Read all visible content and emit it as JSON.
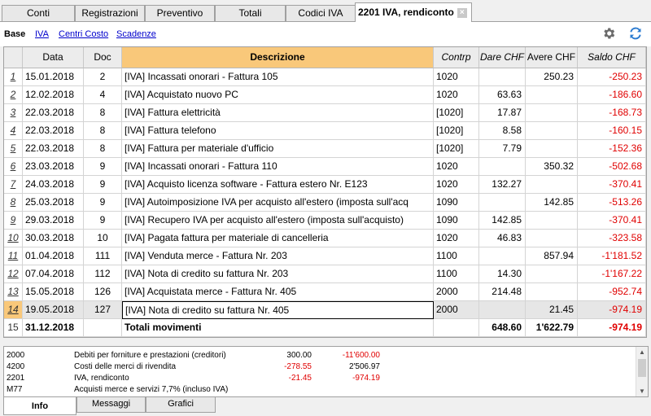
{
  "tabs": [
    {
      "label": "Conti"
    },
    {
      "label": "Registrazioni"
    },
    {
      "label": "Preventivo"
    },
    {
      "label": "Totali"
    },
    {
      "label": "Codici IVA"
    },
    {
      "label": "2201 IVA, rendiconto",
      "active": true
    }
  ],
  "close_symbol": "×",
  "subbar": {
    "base": "Base",
    "links": [
      "IVA",
      "Centri Costo",
      "Scadenze"
    ]
  },
  "icons": {
    "settings": "gear-icon",
    "refresh": "refresh-icon",
    "accent": "#2b7bd0"
  },
  "columns": {
    "date": "Data",
    "doc": "Doc",
    "desc": "Descrizione",
    "contra": "Contrp",
    "debit": "Dare CHF",
    "credit": "Avere CHF",
    "balance": "Saldo CHF"
  },
  "rows": [
    {
      "n": "1",
      "date": "15.01.2018",
      "doc": "2",
      "desc": "[IVA] Incassati onorari - Fattura 105",
      "contra": "1020",
      "debit": "",
      "credit": "250.23",
      "balance": "-250.23"
    },
    {
      "n": "2",
      "date": "12.02.2018",
      "doc": "4",
      "desc": "[IVA] Acquistato nuovo PC",
      "contra": "1020",
      "debit": "63.63",
      "credit": "",
      "balance": "-186.60"
    },
    {
      "n": "3",
      "date": "22.03.2018",
      "doc": "8",
      "desc": "[IVA] Fattura elettricità",
      "contra": "[1020]",
      "debit": "17.87",
      "credit": "",
      "balance": "-168.73"
    },
    {
      "n": "4",
      "date": "22.03.2018",
      "doc": "8",
      "desc": "[IVA] Fattura telefono",
      "contra": "[1020]",
      "debit": "8.58",
      "credit": "",
      "balance": "-160.15"
    },
    {
      "n": "5",
      "date": "22.03.2018",
      "doc": "8",
      "desc": "[IVA] Fattura per materiale d'ufficio",
      "contra": "[1020]",
      "debit": "7.79",
      "credit": "",
      "balance": "-152.36"
    },
    {
      "n": "6",
      "date": "23.03.2018",
      "doc": "9",
      "desc": "[IVA] Incassati onorari - Fattura 110",
      "contra": "1020",
      "debit": "",
      "credit": "350.32",
      "balance": "-502.68"
    },
    {
      "n": "7",
      "date": "24.03.2018",
      "doc": "9",
      "desc": "[IVA] Acquisto licenza software - Fattura estero Nr. E123",
      "contra": "1020",
      "debit": "132.27",
      "credit": "",
      "balance": "-370.41"
    },
    {
      "n": "8",
      "date": "25.03.2018",
      "doc": "9",
      "desc": "[IVA] Autoimposizione IVA per acquisto all'estero (imposta sull'acq",
      "contra": "1090",
      "debit": "",
      "credit": "142.85",
      "balance": "-513.26"
    },
    {
      "n": "9",
      "date": "29.03.2018",
      "doc": "9",
      "desc": "[IVA] Recupero IVA per acquisto all'estero (imposta sull'acquisto)",
      "contra": "1090",
      "debit": "142.85",
      "credit": "",
      "balance": "-370.41"
    },
    {
      "n": "10",
      "date": "30.03.2018",
      "doc": "10",
      "desc": "[IVA] Pagata fattura per materiale di cancelleria",
      "contra": "1020",
      "debit": "46.83",
      "credit": "",
      "balance": "-323.58"
    },
    {
      "n": "11",
      "date": "01.04.2018",
      "doc": "111",
      "desc": "[IVA] Venduta merce - Fattura Nr. 203",
      "contra": "1100",
      "debit": "",
      "credit": "857.94",
      "balance": "-1'181.52"
    },
    {
      "n": "12",
      "date": "07.04.2018",
      "doc": "112",
      "desc": "[IVA] Nota di credito su fattura Nr. 203",
      "contra": "1100",
      "debit": "14.30",
      "credit": "",
      "balance": "-1'167.22"
    },
    {
      "n": "13",
      "date": "15.05.2018",
      "doc": "126",
      "desc": "[IVA] Acquistata merce - Fattura Nr. 405",
      "contra": "2000",
      "debit": "214.48",
      "credit": "",
      "balance": "-952.74"
    },
    {
      "n": "14",
      "date": "19.05.2018",
      "doc": "127",
      "desc": "[IVA] Nota di credito su fattura Nr. 405",
      "contra": "2000",
      "debit": "",
      "credit": "21.45",
      "balance": "-974.19",
      "selected": true
    }
  ],
  "total": {
    "n": "15",
    "date": "31.12.2018",
    "desc": "Totali movimenti",
    "debit": "648.60",
    "credit": "1'622.79",
    "balance": "-974.19"
  },
  "info_lines": [
    {
      "code": "2000",
      "desc": "Debiti per forniture e prestazioni (creditori)",
      "v1": "300.00",
      "v2": "-11'600.00",
      "v1red": false,
      "v2red": true
    },
    {
      "code": "4200",
      "desc": "Costi delle merci di rivendita",
      "v1": "-278.55",
      "v2": "2'506.97",
      "v1red": true,
      "v2red": false
    },
    {
      "code": "2201",
      "desc": "IVA, rendiconto",
      "v1": "-21.45",
      "v2": "-974.19",
      "v1red": true,
      "v2red": true
    },
    {
      "code": "M77",
      "desc": "Acquisti merce e servizi 7,7% (incluso IVA)",
      "v1": "",
      "v2": "",
      "v1red": false,
      "v2red": false
    }
  ],
  "bottom_tabs": [
    "Info",
    "Messaggi",
    "Grafici"
  ],
  "colors": {
    "negative": "#e00000",
    "selected_header": "#f9c87a"
  }
}
